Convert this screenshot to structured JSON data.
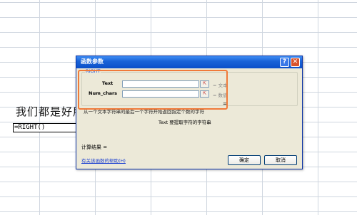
{
  "sheet": {
    "text": "我们都是好朋",
    "formula": "=RIGHT()"
  },
  "dialog": {
    "title": "函数参数",
    "help_glyph": "?",
    "close_glyph": "✕",
    "function_name": "RIGHT",
    "args": [
      {
        "label": "Text",
        "value": "",
        "hint": "= 文本"
      },
      {
        "label": "Num_chars",
        "value": "",
        "hint": "= 数值"
      }
    ],
    "result_eq": "=",
    "description": "从一个文本字符串的最后一个字符开始返回指定个数的字符",
    "arg_description": "Text  要提取字符的字符串",
    "calc_result": "计算结果 =",
    "help_link": "有关该函数的帮助(H)",
    "ok": "确定",
    "cancel": "取消",
    "collapse_glyph": "⇱"
  }
}
